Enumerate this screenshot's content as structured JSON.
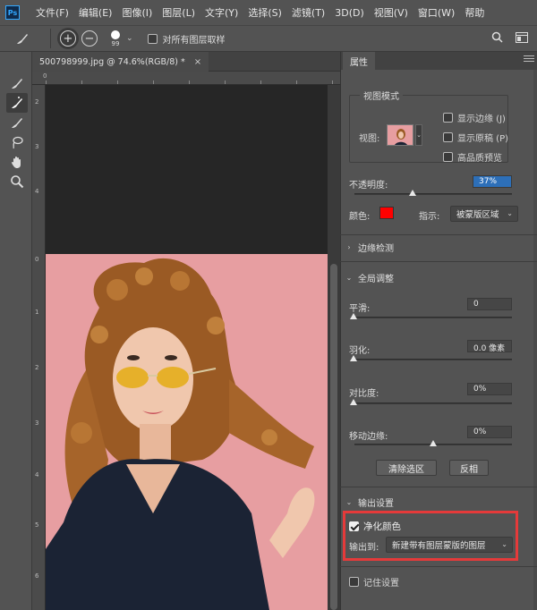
{
  "app": {
    "logo_text": "Ps",
    "menus": [
      "文件(F)",
      "编辑(E)",
      "图像(I)",
      "图层(L)",
      "文字(Y)",
      "选择(S)",
      "滤镜(T)",
      "3D(D)",
      "视图(V)",
      "窗口(W)",
      "帮助"
    ]
  },
  "options_bar": {
    "brush_size": "99",
    "sample_all_layers_label": "对所有图层取样",
    "sample_all_layers_checked": false
  },
  "document": {
    "tab_title": "500798999.jpg @ 74.6%(RGB/8) *",
    "close": "×"
  },
  "rulers": {
    "top_numbers": [
      "0"
    ],
    "left_numbers": [
      "1",
      "2",
      "3",
      "4",
      "0",
      "1",
      "2",
      "3",
      "4",
      "5",
      "6"
    ]
  },
  "panel": {
    "tab": "属性",
    "view_mode": {
      "title": "视图模式",
      "view_label": "视图:",
      "show_edge": "显示边缘 (J)",
      "show_original": "显示原稿 (P)",
      "hq_preview": "高品质预览"
    },
    "opacity": {
      "label": "不透明度:",
      "value": "37%",
      "fraction": 0.37
    },
    "color": {
      "label": "颜色:",
      "swatch": "#ff0000",
      "indicate_label": "指示:",
      "indicate_value": "被蒙版区域"
    },
    "edge_detection": {
      "title": "边缘检测"
    },
    "global": {
      "title": "全局调整",
      "smooth": {
        "label": "平滑:",
        "value": "0"
      },
      "feather": {
        "label": "羽化:",
        "value": "0.0 像素"
      },
      "contrast": {
        "label": "对比度:",
        "value": "0%"
      },
      "shift_edge": {
        "label": "移动边缘:",
        "value": "0%"
      },
      "clear_selection": "清除选区",
      "invert": "反相"
    },
    "output": {
      "title": "输出设置",
      "decontaminate_label": "净化颜色",
      "decontaminate_checked": true,
      "output_to_label": "输出到:",
      "output_to_value": "新建带有图层蒙版的图层",
      "remember_label": "记住设置",
      "remember_checked": false
    }
  },
  "colors": {
    "highlight": "#e53a3a",
    "photo_bg": "#e79ea1",
    "field_active": "#2d6fb8"
  }
}
